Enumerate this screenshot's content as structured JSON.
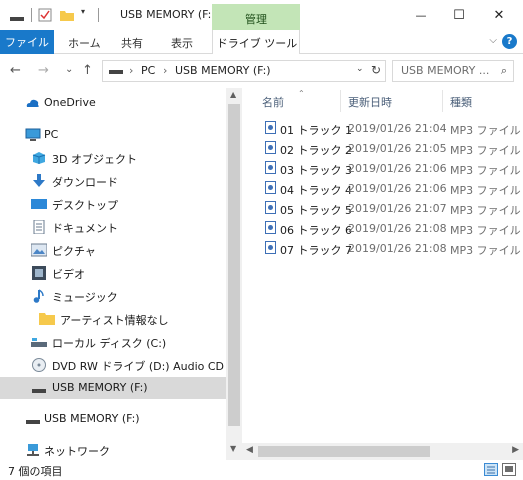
{
  "window": {
    "title": "USB MEMORY (F:)",
    "manage_tab": "管理",
    "controls": {
      "minimize": "—",
      "maximize": "☐",
      "close": "✕"
    }
  },
  "ribbon": {
    "tabs": [
      "ファイル",
      "ホーム",
      "共有",
      "表示"
    ],
    "context_tab": "ドライブ ツール",
    "expand": "⌵",
    "help": "?"
  },
  "address": {
    "back": "←",
    "forward": "→",
    "recent": "⌄",
    "up": "↑",
    "crumbs": [
      "PC",
      "USB MEMORY (F:)"
    ],
    "separator": "›",
    "dropdown": "⌄",
    "refresh": "↻",
    "search_placeholder": "USB MEMORY ...",
    "search_icon": "⌕"
  },
  "nav": {
    "items": [
      {
        "label": "OneDrive",
        "icon": "cloud-icon"
      },
      {
        "label": "PC",
        "icon": "computer-icon"
      },
      {
        "label": "3D オブジェクト",
        "icon": "3d-objects-icon"
      },
      {
        "label": "ダウンロード",
        "icon": "download-icon"
      },
      {
        "label": "デスクトップ",
        "icon": "desktop-icon"
      },
      {
        "label": "ドキュメント",
        "icon": "documents-icon"
      },
      {
        "label": "ピクチャ",
        "icon": "pictures-icon"
      },
      {
        "label": "ビデオ",
        "icon": "videos-icon"
      },
      {
        "label": "ミュージック",
        "icon": "music-icon"
      },
      {
        "label": "アーティスト情報なし",
        "icon": "folder-icon"
      },
      {
        "label": "ローカル ディスク (C:)",
        "icon": "local-disk-icon"
      },
      {
        "label": "DVD RW ドライブ (D:) Audio CD",
        "icon": "dvd-drive-icon"
      },
      {
        "label": "USB MEMORY (F:)",
        "icon": "usb-drive-icon"
      },
      {
        "label": "USB MEMORY (F:)",
        "icon": "usb-drive-icon"
      },
      {
        "label": "ネットワーク",
        "icon": "network-icon"
      }
    ],
    "selected_index": 12
  },
  "files": {
    "columns": [
      "名前",
      "更新日時",
      "種類"
    ],
    "rows": [
      {
        "name": "01 トラック 1",
        "date": "2019/01/26 21:04",
        "type": "MP3 ファイル"
      },
      {
        "name": "02 トラック 2",
        "date": "2019/01/26 21:05",
        "type": "MP3 ファイル"
      },
      {
        "name": "03 トラック 3",
        "date": "2019/01/26 21:06",
        "type": "MP3 ファイル"
      },
      {
        "name": "04 トラック 4",
        "date": "2019/01/26 21:06",
        "type": "MP3 ファイル"
      },
      {
        "name": "05 トラック 5",
        "date": "2019/01/26 21:07",
        "type": "MP3 ファイル"
      },
      {
        "name": "06 トラック 6",
        "date": "2019/01/26 21:08",
        "type": "MP3 ファイル"
      },
      {
        "name": "07 トラック 7",
        "date": "2019/01/26 21:08",
        "type": "MP3 ファイル"
      }
    ]
  },
  "status": {
    "item_count": "7 個の項目"
  },
  "colors": {
    "accent": "#1979ca",
    "manage_tab": "#c3e5b7",
    "selected": "#d9d9d9"
  }
}
